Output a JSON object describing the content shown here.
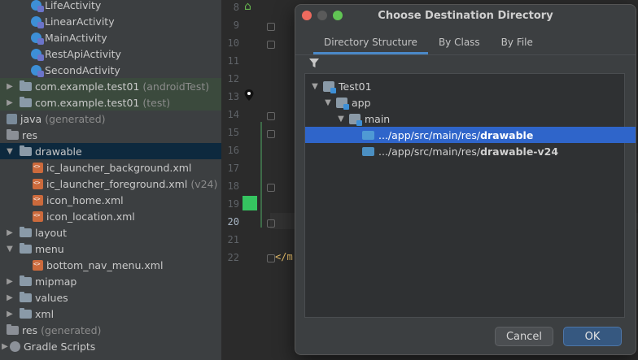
{
  "project_tree": {
    "items": [
      {
        "label": "LifeActivity",
        "icon": "activity-icon"
      },
      {
        "label": "LinearActivity",
        "icon": "activity-icon"
      },
      {
        "label": "MainActivity",
        "icon": "activity-icon"
      },
      {
        "label": "RestApiActivity",
        "icon": "activity-icon"
      },
      {
        "label": "SecondActivity",
        "icon": "activity-icon"
      },
      {
        "label": "com.example.test01",
        "suffix": "(androidTest)",
        "icon": "package-folder-icon"
      },
      {
        "label": "com.example.test01",
        "suffix": "(test)",
        "icon": "package-folder-icon"
      },
      {
        "label": "java",
        "suffix": "(generated)",
        "icon": "java-folder-icon"
      },
      {
        "label": "res",
        "icon": "res-folder-icon"
      },
      {
        "label": "drawable",
        "icon": "folder-icon"
      },
      {
        "label": "ic_launcher_background.xml",
        "icon": "xml-file-icon"
      },
      {
        "label": "ic_launcher_foreground.xml",
        "suffix": "(v24)",
        "icon": "xml-file-icon"
      },
      {
        "label": "icon_home.xml",
        "icon": "xml-file-icon"
      },
      {
        "label": "icon_location.xml",
        "icon": "xml-file-icon"
      },
      {
        "label": "layout",
        "icon": "folder-icon"
      },
      {
        "label": "menu",
        "icon": "folder-icon"
      },
      {
        "label": "bottom_nav_menu.xml",
        "icon": "xml-file-icon"
      },
      {
        "label": "mipmap",
        "icon": "folder-icon"
      },
      {
        "label": "values",
        "icon": "folder-icon"
      },
      {
        "label": "xml",
        "icon": "folder-icon"
      },
      {
        "label": "res",
        "suffix": "(generated)",
        "icon": "res-folder-icon"
      },
      {
        "label": "Gradle Scripts",
        "icon": "gradle-icon"
      }
    ]
  },
  "editor": {
    "line_numbers": [
      "8",
      "9",
      "10",
      "11",
      "12",
      "13",
      "14",
      "15",
      "16",
      "17",
      "18",
      "19",
      "20",
      "21",
      "22"
    ],
    "current_line": "20",
    "closing_tag_text": "</m"
  },
  "dialog": {
    "title": "Choose Destination Directory",
    "tabs": [
      {
        "label": "Directory Structure",
        "active": true
      },
      {
        "label": "By Class",
        "active": false
      },
      {
        "label": "By File",
        "active": false
      }
    ],
    "tree": {
      "root": "Test01",
      "module": "app",
      "source_set": "main",
      "entries": [
        {
          "prefix": ".../app/src/main/res/",
          "bold": "drawable",
          "selected": true
        },
        {
          "prefix": ".../app/src/main/res/",
          "bold": "drawable-v24",
          "selected": false
        }
      ]
    },
    "buttons": {
      "cancel": "Cancel",
      "ok": "OK"
    }
  },
  "colors": {
    "selection": "#2f65ca",
    "accent_tab": "#4a88c7",
    "ok_button": "#365880",
    "close": "#ed6a5e",
    "minimize": "#5a5a5a",
    "zoom": "#61c554",
    "changed_line": "#35c460"
  }
}
